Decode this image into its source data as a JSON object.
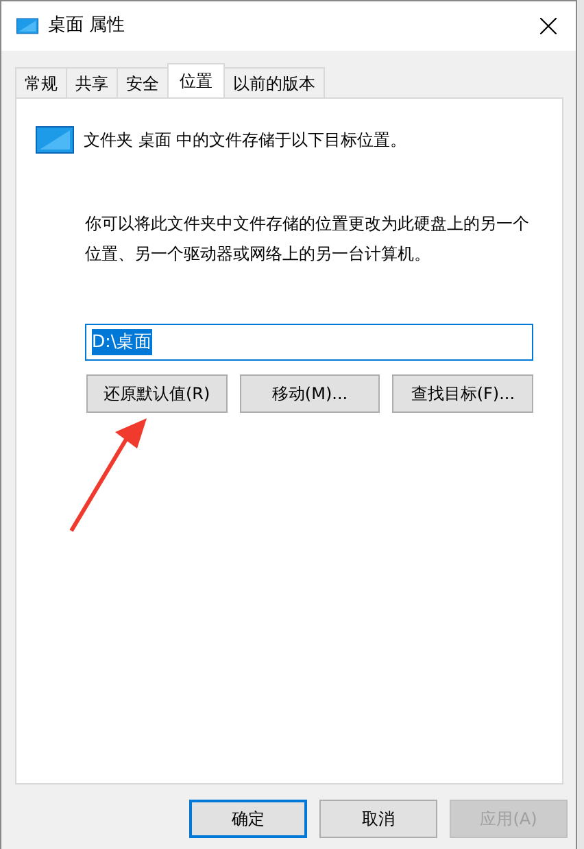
{
  "window": {
    "title": "桌面 属性"
  },
  "tabs": [
    {
      "label": "常规",
      "selected": false
    },
    {
      "label": "共享",
      "selected": false
    },
    {
      "label": "安全",
      "selected": false
    },
    {
      "label": "位置",
      "selected": true
    },
    {
      "label": "以前的版本",
      "selected": false
    }
  ],
  "location": {
    "heading": "文件夹 桌面 中的文件存储于以下目标位置。",
    "description": "你可以将此文件夹中文件存储的位置更改为此硬盘上的另一个位置、另一个驱动器或网络上的另一台计算机。",
    "path": "D:\\桌面",
    "path_selected": true,
    "buttons": [
      {
        "label": "还原默认值(R)"
      },
      {
        "label": "移动(M)..."
      },
      {
        "label": "查找目标(F)..."
      }
    ]
  },
  "annotation": {
    "kind": "arrow"
  },
  "footer_buttons": [
    {
      "label": "确定",
      "default": true,
      "disabled": false
    },
    {
      "label": "取消",
      "default": false,
      "disabled": false
    },
    {
      "label": "应用(A)",
      "default": false,
      "disabled": true
    }
  ]
}
